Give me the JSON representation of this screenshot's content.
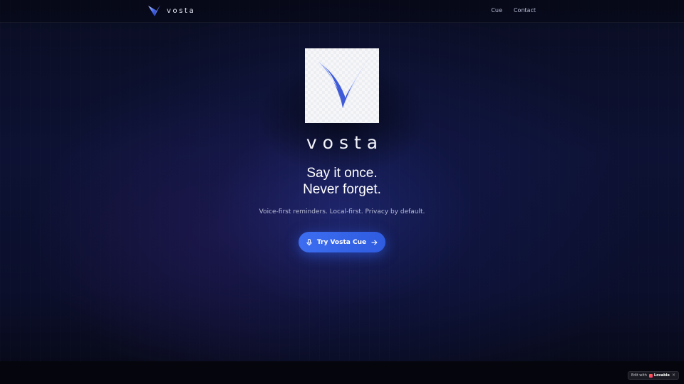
{
  "header": {
    "brand_name": "vosta",
    "nav": [
      {
        "label": "Cue"
      },
      {
        "label": "Contact"
      }
    ]
  },
  "hero": {
    "wordmark": "vosta",
    "headline_line1": "Say it once.",
    "headline_line2": "Never forget.",
    "tagline": "Voice-first reminders. Local-first. Privacy by default.",
    "cta_label": "Try Vosta Cue"
  },
  "badge": {
    "prefix": "Edit with",
    "brand": "Lovable",
    "close": "×"
  },
  "icons": {
    "brand_logo": "v-logo-icon",
    "cta_leading": "microphone-icon",
    "cta_trailing": "arrow-right-icon"
  },
  "colors": {
    "background": "#0b0f2c",
    "accent": "#3c6df0",
    "logo_blue": "#2a4fd8",
    "text_muted": "#b8bcd6"
  }
}
